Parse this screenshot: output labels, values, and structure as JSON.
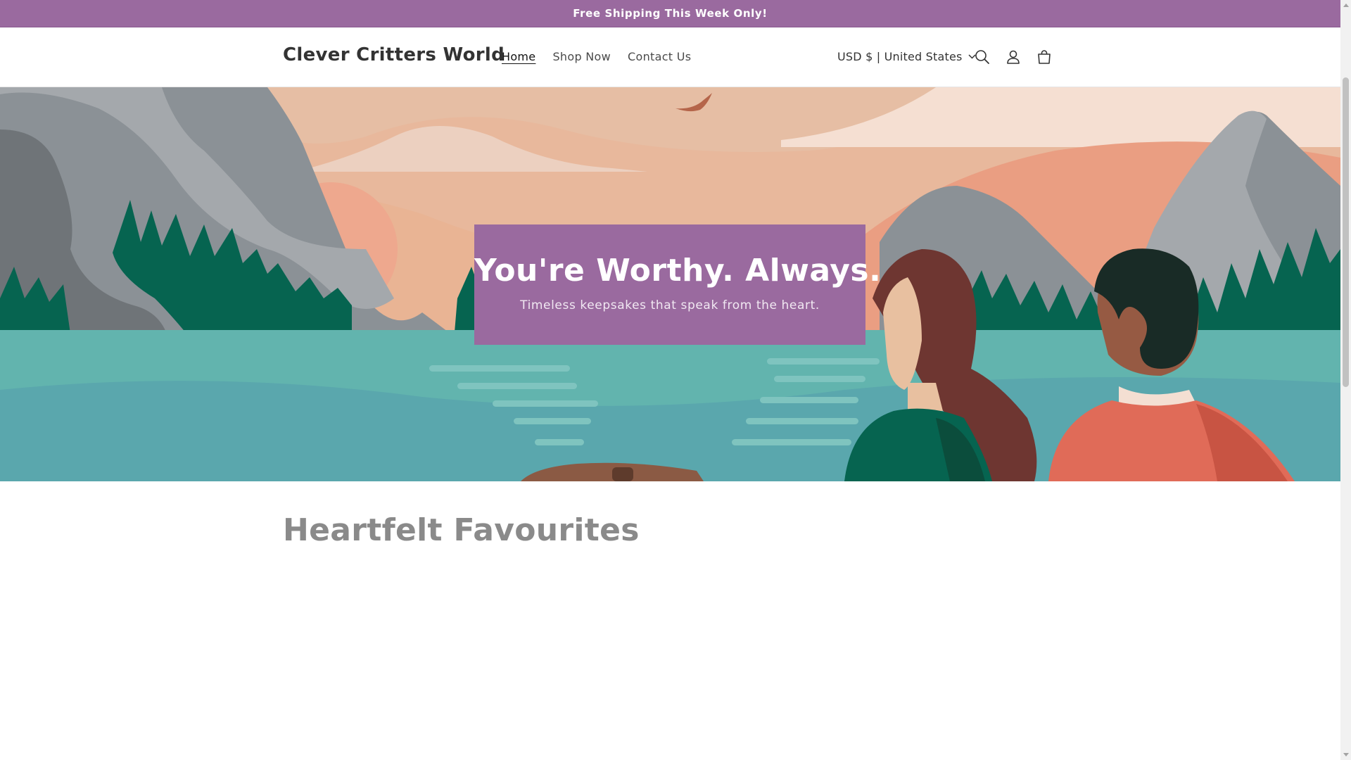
{
  "announcement": {
    "text": "Free Shipping This Week Only!"
  },
  "header": {
    "logo": "Clever Critters World",
    "nav": [
      {
        "label": "Home",
        "active": true
      },
      {
        "label": "Shop Now",
        "active": false
      },
      {
        "label": "Contact Us",
        "active": false
      }
    ],
    "currency": "USD $ | United States"
  },
  "hero": {
    "title": "You're Worthy. Always.",
    "subtitle": "Timeless keepsakes that speak from the heart."
  },
  "featured": {
    "title": "Heartfelt Favourites"
  },
  "colors": {
    "brand": "#9a6a9f",
    "lake": "#62b4ae",
    "forest": "#066450",
    "mountain": "#8b9196"
  }
}
